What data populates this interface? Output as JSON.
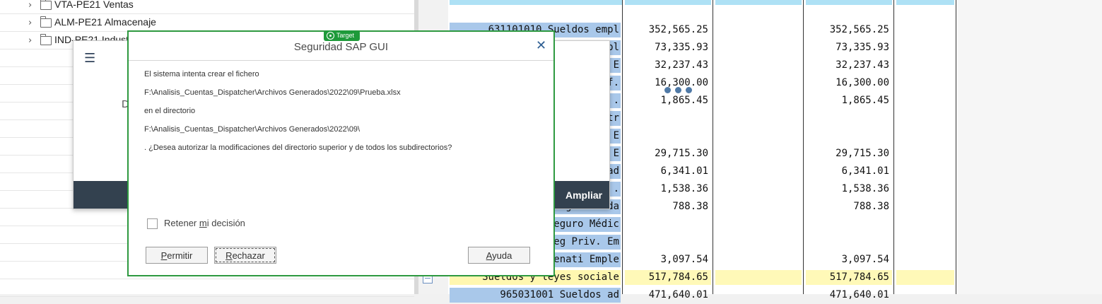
{
  "tree": {
    "items": [
      {
        "label": "VTA-PE21 Ventas"
      },
      {
        "label": "ALM-PE21 Almacenaje"
      },
      {
        "label": "IND-PE21 Indust"
      }
    ]
  },
  "table": {
    "rows": [
      {
        "account": "631101010  Sueldos empl",
        "col1": "352,565.25",
        "col3": "352,565.25",
        "highlight": false
      },
      {
        "account": "pl",
        "col1": "73,335.93",
        "col3": "73,335.93",
        "highlight": false
      },
      {
        "account": "E",
        "col1": "32,237.43",
        "col3": "32,237.43",
        "highlight": false
      },
      {
        "account": "f.",
        "col1": "16,300.00",
        "col3": "16,300.00",
        "highlight": false
      },
      {
        "account": ".",
        "col1": "1,865.45",
        "col3": "1,865.45",
        "highlight": false
      },
      {
        "account": "tr",
        "col1": "",
        "col3": "",
        "highlight": false
      },
      {
        "account": "E",
        "col1": "",
        "col3": "",
        "highlight": false
      },
      {
        "account": "E",
        "col1": "29,715.30",
        "col3": "29,715.30",
        "highlight": false
      },
      {
        "account": "ad",
        "col1": "6,341.01",
        "col3": "6,341.01",
        "highlight": false
      },
      {
        "account": ".",
        "col1": "1,538.36",
        "col3": "1,538.36",
        "highlight": false
      },
      {
        "account": "Seguro Vida",
        "col1": "788.38",
        "col3": "788.38",
        "highlight": false
      },
      {
        "account": "Seguro Médic",
        "col1": "",
        "col3": "",
        "highlight": false
      },
      {
        "account": "Seg Priv. Em",
        "col1": "",
        "col3": "",
        "highlight": false
      },
      {
        "account": "Senati Emple",
        "col1": "3,097.54",
        "col3": "3,097.54",
        "highlight": false
      },
      {
        "account": "Sueldos y leyes sociale",
        "col1": "517,784.65",
        "col3": "517,784.65",
        "highlight": true
      },
      {
        "account": "965031001  Sueldos ad",
        "col1": "471,640.01",
        "col3": "471,640.01",
        "highlight": false
      }
    ]
  },
  "background_panel": {
    "letter": "D",
    "ampliar_label": "Ampliar"
  },
  "target_badge": "Target",
  "dialog": {
    "title": "Seguridad SAP GUI",
    "close_glyph": "✕",
    "messages": [
      "El sistema intenta crear el fichero",
      "F:\\Analisis_Cuentas_Dispatcher\\Archivos Generados\\2022\\09\\Prueba.xlsx",
      "en el directorio",
      "F:\\Analisis_Cuentas_Dispatcher\\Archivos Generados\\2022\\09\\",
      ". ¿Desea autorizar la modificaciones del directorio superior y de todos los subdirectorios?"
    ],
    "retain": {
      "before": "Retener ",
      "mnemonic": "m",
      "after": "i decisión",
      "checked": false
    },
    "buttons": {
      "permitir": {
        "mnemonic": "P",
        "rest": "ermitir"
      },
      "rechazar": {
        "mnemonic": "R",
        "rest": "echazar"
      },
      "ayuda": {
        "mnemonic": "A",
        "rest": "yuda"
      }
    }
  }
}
